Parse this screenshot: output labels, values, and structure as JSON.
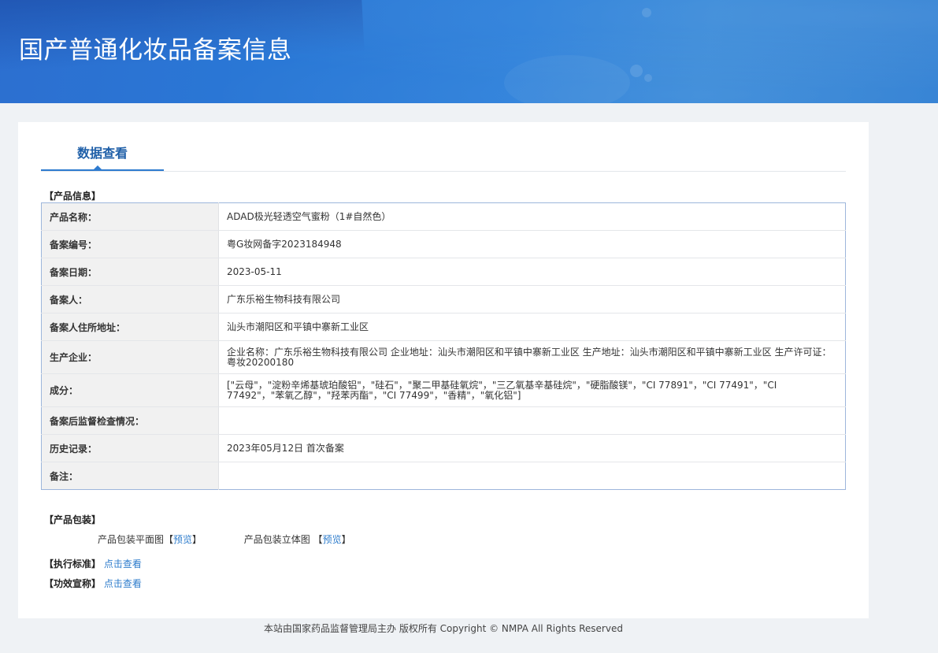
{
  "header": {
    "title": "国产普通化妆品备案信息"
  },
  "tabs": [
    {
      "label": "数据查看"
    }
  ],
  "product_info": {
    "section_title": "【产品信息】",
    "rows": [
      {
        "label": "产品名称：",
        "value": "ADAD极光轻透空气蜜粉（1#自然色）"
      },
      {
        "label": "备案编号：",
        "value": "粤G妆网备字2023184948"
      },
      {
        "label": "备案日期：",
        "value": "2023-05-11"
      },
      {
        "label": "备案人：",
        "value": "广东乐裕生物科技有限公司"
      },
      {
        "label": "备案人住所地址：",
        "value": "汕头市潮阳区和平镇中寨新工业区"
      },
      {
        "label": "生产企业：",
        "value": "企业名称：广东乐裕生物科技有限公司 企业地址：汕头市潮阳区和平镇中寨新工业区 生产地址：汕头市潮阳区和平镇中寨新工业区 生产许可证：粤妆20200180"
      },
      {
        "label": "成分：",
        "value": "[\"云母\"，\"淀粉辛烯基琥珀酸铝\"，\"硅石\"，\"聚二甲基硅氧烷\"，\"三乙氧基辛基硅烷\"，\"硬脂酸镁\"，\"CI 77891\"，\"CI 77491\"，\"CI 77492\"，\"苯氧乙醇\"，\"羟苯丙酯\"，\"CI 77499\"，\"香精\"，\"氧化铝\"]"
      },
      {
        "label": "备案后监督检查情况：",
        "value": ""
      },
      {
        "label": "历史记录：",
        "value": "2023年05月12日 首次备案"
      },
      {
        "label": "备注：",
        "value": ""
      }
    ]
  },
  "packaging": {
    "section_title": "【产品包装】",
    "flat_label": "产品包装平面图",
    "flat_bracket_open": "【",
    "flat_link": "预览",
    "flat_bracket_close": "】",
    "stereo_label": "产品包装立体图 ",
    "stereo_bracket_open": "【",
    "stereo_link": "预览",
    "stereo_bracket_close": "】"
  },
  "standard": {
    "section_title": "【执行标准】",
    "link": "点击查看"
  },
  "efficacy": {
    "section_title": "【功效宣称】",
    "link": "点击查看"
  },
  "footer": {
    "text": "本站由国家药品监督管理局主办 版权所有 Copyright © NMPA All Rights Reserved"
  },
  "colors": {
    "header_blue": "#2b7bd6",
    "tab_active": "#1f5fa8",
    "link": "#2f7dcc",
    "label_bg": "#f1f1f1",
    "page_bg": "#eff2f5"
  }
}
